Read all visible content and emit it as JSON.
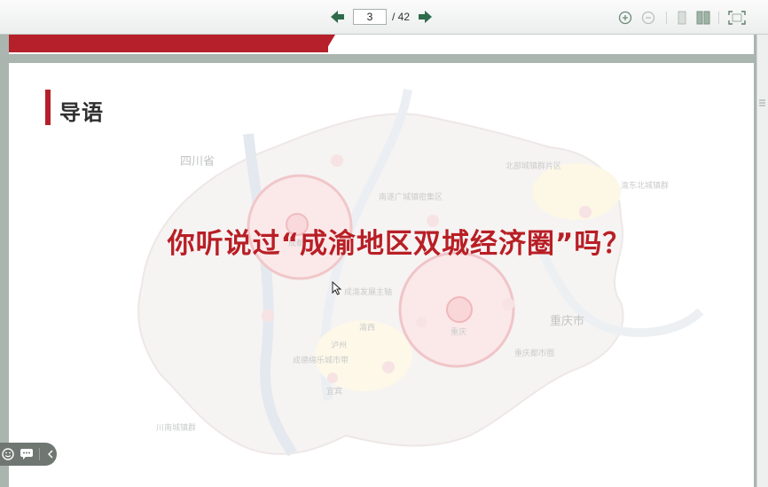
{
  "toolbar": {
    "current_page": "3",
    "total_pages": "/ 42"
  },
  "slide": {
    "heading": "导语",
    "question": "你听说过“成渝地区双城经济圈”吗？"
  },
  "map_labels": {
    "province": "四川省",
    "city": "重庆市",
    "small": [
      "北部城镇群片区",
      "渝东北城镇群",
      "成都",
      "重庆",
      "川南城镇群",
      "成德绵乐城市带",
      "南遂广城镇密集区",
      "成渝发展主轴",
      "渝西",
      "泸州",
      "宜宾",
      "重庆都市圈"
    ]
  },
  "colors": {
    "accent_red": "#b81f25",
    "heading_text": "#2f2f2f"
  }
}
